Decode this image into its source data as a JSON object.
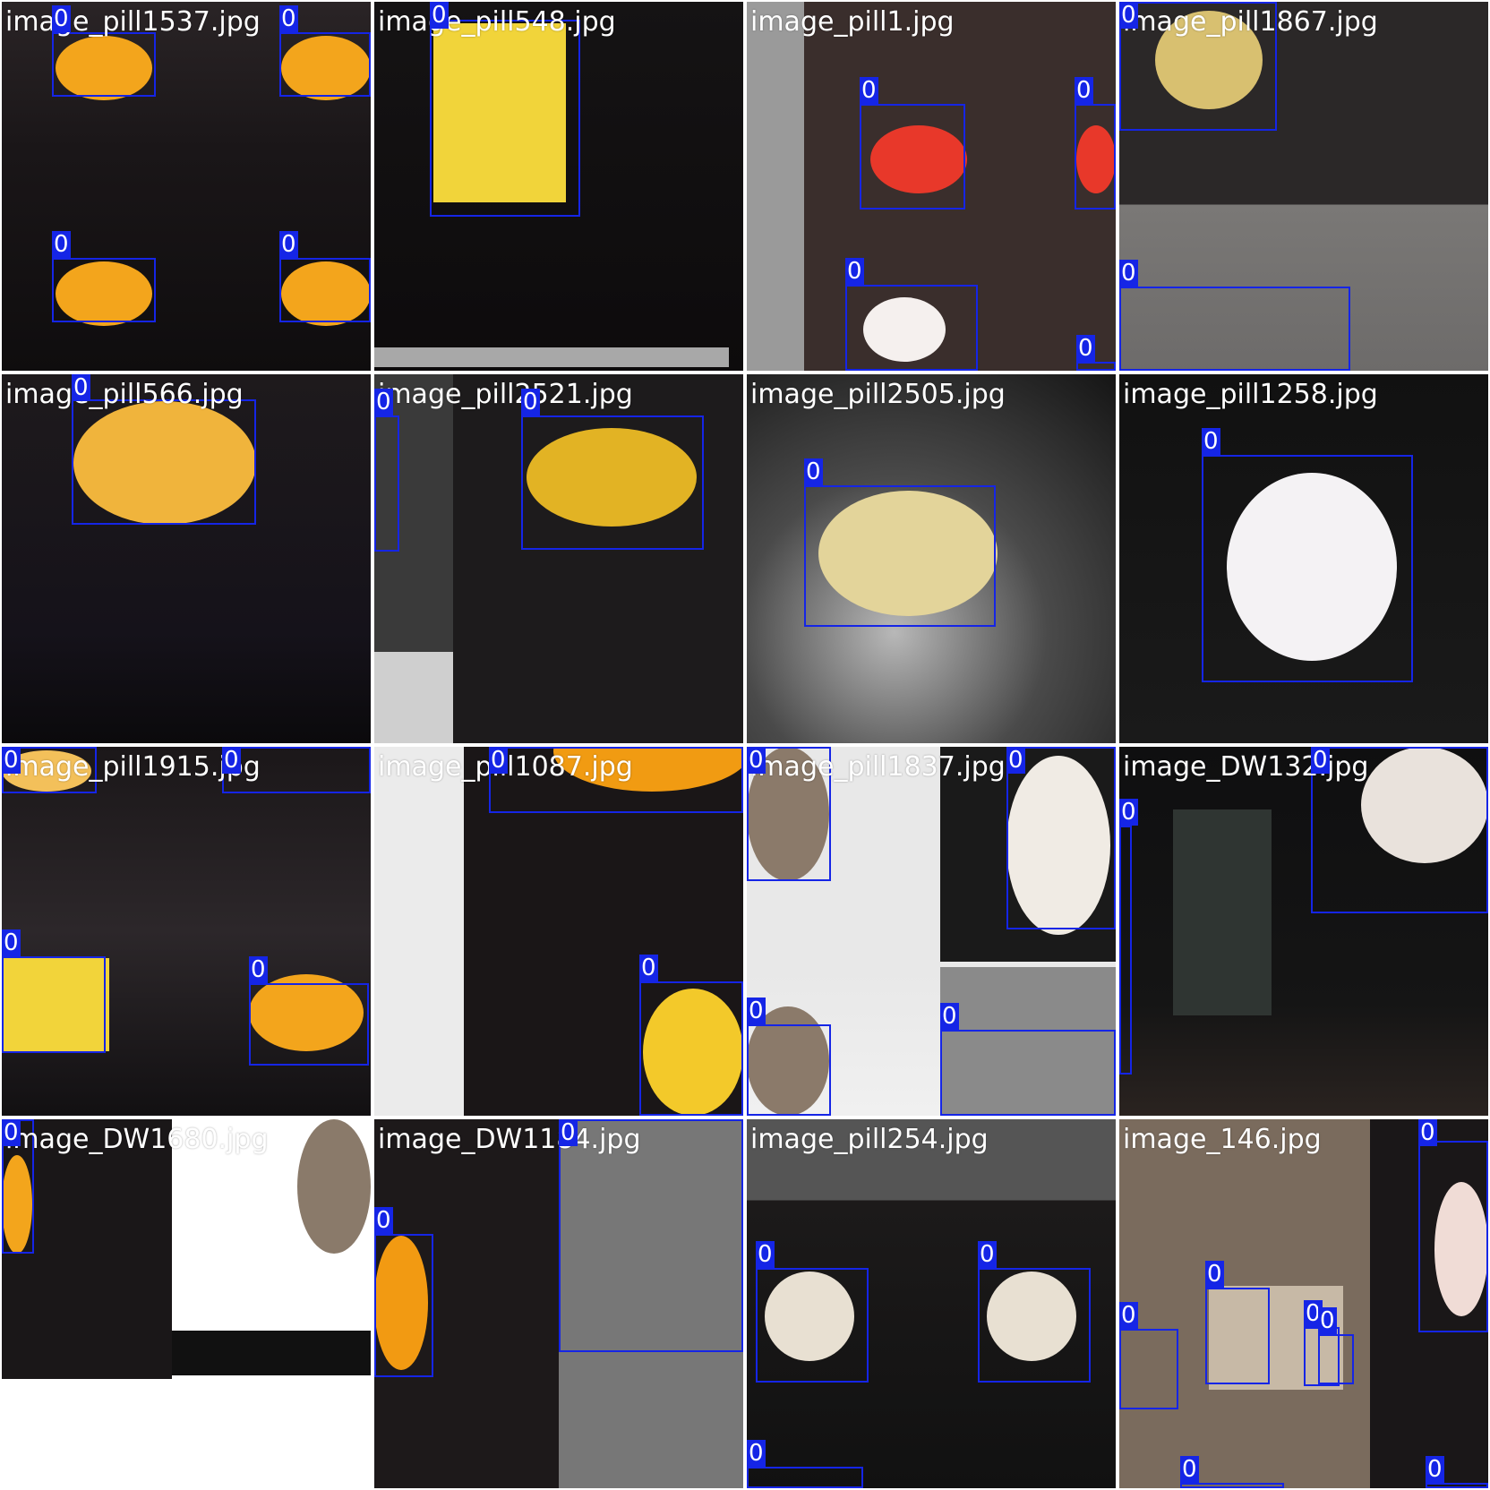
{
  "grid": {
    "tiles": [
      {
        "caption": "image_pill1537.jpg",
        "label": "0"
      },
      {
        "caption": "image_pill548.jpg",
        "label": "0"
      },
      {
        "caption": "image_pill1.jpg",
        "label": "0"
      },
      {
        "caption": "image_pill1867.jpg",
        "label": "0"
      },
      {
        "caption": "image_pill566.jpg",
        "label": "0"
      },
      {
        "caption": "image_pill2521.jpg",
        "label": "0"
      },
      {
        "caption": "image_pill2505.jpg",
        "label": "0"
      },
      {
        "caption": "image_pill1258.jpg",
        "label": "0"
      },
      {
        "caption": "image_pill1915.jpg",
        "label": "0"
      },
      {
        "caption": "image_pill1087.jpg",
        "label": "0"
      },
      {
        "caption": "image_pill1837.jpg",
        "label": "0"
      },
      {
        "caption": "image_DW132.jpg",
        "label": "0"
      },
      {
        "caption": "image_DW1680.jpg",
        "label": "0"
      },
      {
        "caption": "image_DW1184.jpg",
        "label": "0"
      },
      {
        "caption": "image_pill254.jpg",
        "label": "0"
      },
      {
        "caption": "image_146.jpg",
        "label": "0"
      }
    ]
  },
  "style": {
    "box_color": "#1525e6",
    "caption_color": "#ffffff"
  }
}
